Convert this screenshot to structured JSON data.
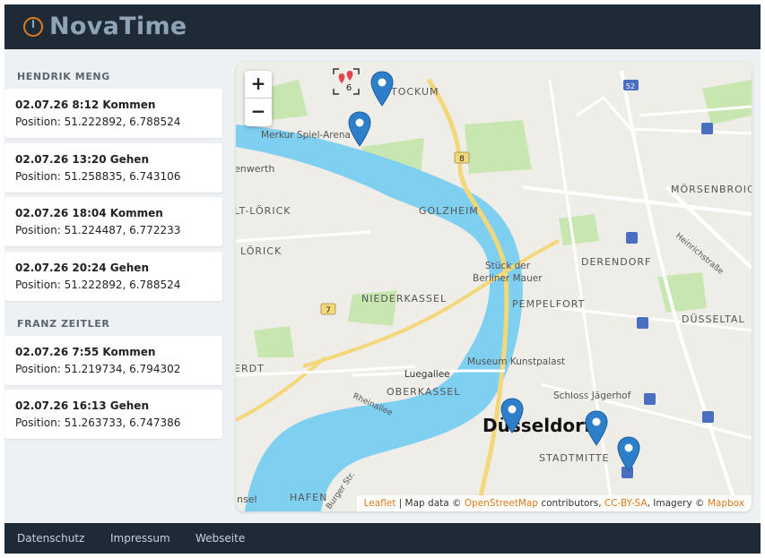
{
  "app": {
    "name": "NovaTime"
  },
  "groups": [
    {
      "name": "HENDRIK MENG",
      "entries": [
        {
          "title": "02.07.26 8:12 Kommen",
          "position": "Position: 51.222892, 6.788524"
        },
        {
          "title": "02.07.26 13:20 Gehen",
          "position": "Position: 51.258835, 6.743106"
        },
        {
          "title": "02.07.26 18:04 Kommen",
          "position": "Position: 51.224487, 6.772233"
        },
        {
          "title": "02.07.26 20:24 Gehen",
          "position": "Position: 51.222892, 6.788524"
        }
      ]
    },
    {
      "name": "FRANZ ZEITLER",
      "entries": [
        {
          "title": "02.07.26 7:55 Kommen",
          "position": "Position: 51.219734, 6.794302"
        },
        {
          "title": "02.07.26 16:13 Gehen",
          "position": "Position: 51.263733, 6.747386"
        }
      ]
    }
  ],
  "map": {
    "zoom_in": "+",
    "zoom_out": "−",
    "cluster_count": "6",
    "labels": {
      "stockum": "STOCKUM",
      "merkur": "Merkur Spiel-Arena",
      "lohausen": "enwerth",
      "lorick_alt": "LT-LÖRICK",
      "lorick": "LÖRICK",
      "golzheim": "GOLZHEIM",
      "moersenbroich": "MÖRSENBROIC",
      "stueck": "Stück der",
      "berliner": "Berliner Mauer",
      "derendorf": "DERENDORF",
      "heinrich": "Heinrichstraße",
      "niederkassel": "NIEDERKASSEL",
      "pempelfort": "PEMPELFORT",
      "duesseltal": "DÜSSELTAL",
      "kunstpalast": "Museum Kunstpalast",
      "luegallee": "Luegallee",
      "oberkassel": "OBERKASSEL",
      "rheinallee": "Rheinallee",
      "heerdt": "ERDT",
      "jaegerhof": "Schloss Jägerhof",
      "city": "Düsseldorf",
      "stadtmitte": "STADTMITTE",
      "hafen": "HAFEN",
      "burger": "Burger Str.",
      "insel": "insel",
      "route8": "8",
      "route7": "7",
      "route52": "52"
    },
    "attribution": {
      "leaflet": "Leaflet",
      "sep": " | Map data © ",
      "osm": "OpenStreetMap",
      "contrib": " contributors, ",
      "license": "CC-BY-SA",
      "imagery": ", Imagery © ",
      "mapbox": "Mapbox"
    }
  },
  "footer": {
    "links": [
      "Datenschutz",
      "Impressum",
      "Webseite"
    ]
  },
  "colors": {
    "header": "#1e2a36",
    "logo": "#8ea4b6",
    "logo_accent": "#e07b1f",
    "marker": "#2d7fca",
    "water": "#7fcff0",
    "park": "#c7e6b0",
    "road_major": "#f4d77a"
  }
}
